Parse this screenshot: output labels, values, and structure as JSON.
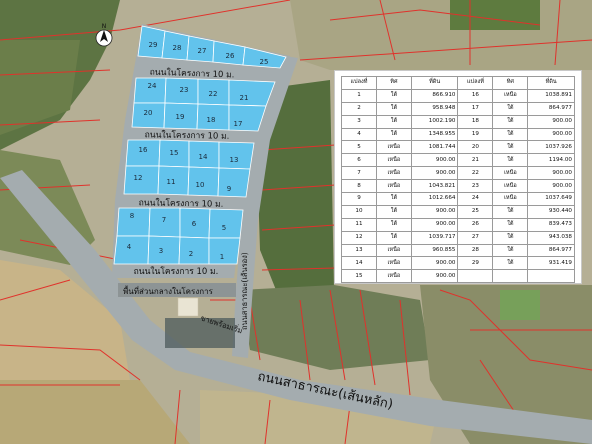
{
  "map": {
    "north_label": "N",
    "inner_road_label": "ถนนในโครงการ 10 ม.",
    "side_road_label": "ถนนสาธารณะ(เส้นรอง)",
    "main_road_label": "ถนนสาธารณะ(เส้นหลัก)",
    "common_area_label": "พื้นที่ส่วนกลางในโครงการ",
    "building_label": "ขายพร้อมเริ่ม",
    "plots": [
      "1",
      "2",
      "3",
      "4",
      "5",
      "6",
      "7",
      "8",
      "9",
      "10",
      "11",
      "12",
      "13",
      "14",
      "15",
      "16",
      "17",
      "18",
      "19",
      "20",
      "21",
      "22",
      "23",
      "24",
      "25",
      "26",
      "27",
      "28",
      "29"
    ],
    "colors": {
      "plot_fill": "#62c3ec",
      "plot_border": "#ffffff",
      "road_fill": "#9aa4a7",
      "boundary_red": "#e0322b",
      "farmland": "#b7b196",
      "vegetation": "#4f6a3b"
    }
  },
  "table": {
    "headers": [
      "แปลงที่",
      "ทิศ",
      "ที่ดิน",
      "แปลงที่",
      "ทิศ",
      "ที่ดิน"
    ],
    "rows": [
      [
        "1",
        "ใต้",
        "866.910",
        "16",
        "เหนือ",
        "1038.891"
      ],
      [
        "2",
        "ใต้",
        "958.948",
        "17",
        "ใต้",
        "864.977"
      ],
      [
        "3",
        "ใต้",
        "1002.190",
        "18",
        "ใต้",
        "900.00"
      ],
      [
        "4",
        "ใต้",
        "1348.955",
        "19",
        "ใต้",
        "900.00"
      ],
      [
        "5",
        "เหนือ",
        "1081.744",
        "20",
        "ใต้",
        "1037.926"
      ],
      [
        "6",
        "เหนือ",
        "900.00",
        "21",
        "ใต้",
        "1194.00"
      ],
      [
        "7",
        "เหนือ",
        "900.00",
        "22",
        "เหนือ",
        "900.00"
      ],
      [
        "8",
        "เหนือ",
        "1043.821",
        "23",
        "เหนือ",
        "900.00"
      ],
      [
        "9",
        "ใต้",
        "1012.664",
        "24",
        "เหนือ",
        "1037.649"
      ],
      [
        "10",
        "ใต้",
        "900.00",
        "25",
        "ใต้",
        "930.440"
      ],
      [
        "11",
        "ใต้",
        "900.00",
        "26",
        "ใต้",
        "839.473"
      ],
      [
        "12",
        "ใต้",
        "1039.717",
        "27",
        "ใต้",
        "943.038"
      ],
      [
        "13",
        "เหนือ",
        "960.855",
        "28",
        "ใต้",
        "864.977"
      ],
      [
        "14",
        "เหนือ",
        "900.00",
        "29",
        "ใต้",
        "931.419"
      ],
      [
        "15",
        "เหนือ",
        "900.00",
        "",
        "",
        " "
      ]
    ]
  }
}
